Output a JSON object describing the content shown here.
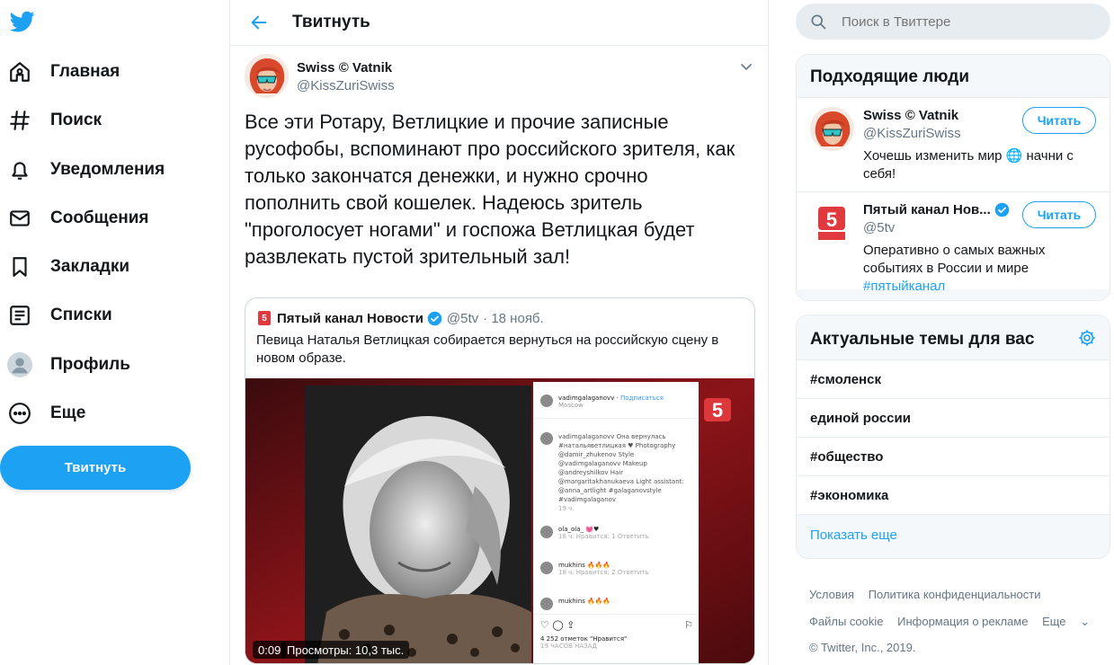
{
  "nav": {
    "items": [
      {
        "label": "Главная",
        "icon": "home-icon"
      },
      {
        "label": "Поиск",
        "icon": "hashtag-icon"
      },
      {
        "label": "Уведомления",
        "icon": "bell-icon"
      },
      {
        "label": "Сообщения",
        "icon": "envelope-icon"
      },
      {
        "label": "Закладки",
        "icon": "bookmark-icon"
      },
      {
        "label": "Списки",
        "icon": "list-icon"
      },
      {
        "label": "Профиль",
        "icon": "profile-icon"
      },
      {
        "label": "Еще",
        "icon": "more-icon"
      }
    ],
    "tweet_button": "Твитнуть"
  },
  "header": {
    "title": "Твитнуть"
  },
  "tweet": {
    "author_name": "Swiss © Vatnik",
    "author_handle": "@KissZuriSwiss",
    "text": "Все эти Ротару, Ветлицкие и прочие записные русофобы, вспоминают про российского зрителя, как только закончатся денежки, и нужно срочно пополнить свой кошелек. Надеюсь зритель \"проголосует ногами\" и госпожа Ветлицкая будет развлекать пустой зрительный зал!",
    "quote": {
      "name": "Пятый канал Новости",
      "handle": "@5tv",
      "date": "· 18 нояб.",
      "text": "Певица Наталья Ветлицкая собирается вернуться на российскую сцену в новом образе.",
      "duration": "0:09",
      "views": "Просмотры: 10,3 тыс."
    }
  },
  "search": {
    "placeholder": "Поиск в Твиттере"
  },
  "who_to_follow": {
    "title": "Подходящие люди",
    "follow_label": "Читать",
    "people": [
      {
        "name": "Swiss © Vatnik",
        "handle": "@KissZuriSwiss",
        "bio": "Хочешь изменить мир 🌐 начни с себя!"
      },
      {
        "name": "Пятый канал Нов...",
        "handle": "@5tv",
        "bio": "Оперативно о самых важных событиях в России и мире",
        "bio_link": "#пятыйканал"
      }
    ]
  },
  "trends": {
    "title": "Актуальные темы для вас",
    "items": [
      "#смоленск",
      "единой россии",
      "#общество",
      "#экономика"
    ],
    "show_more": "Показать еще"
  },
  "footer": {
    "line1": [
      "Условия",
      "Политика конфиденциальности"
    ],
    "line2": [
      "Файлы cookie",
      "Информация о рекламе",
      "Еще"
    ],
    "copyright": "© Twitter, Inc., 2019."
  },
  "colors": {
    "accent": "#1da1f2",
    "text": "#14171a",
    "muted": "#657786",
    "border": "#e6ecf0"
  }
}
